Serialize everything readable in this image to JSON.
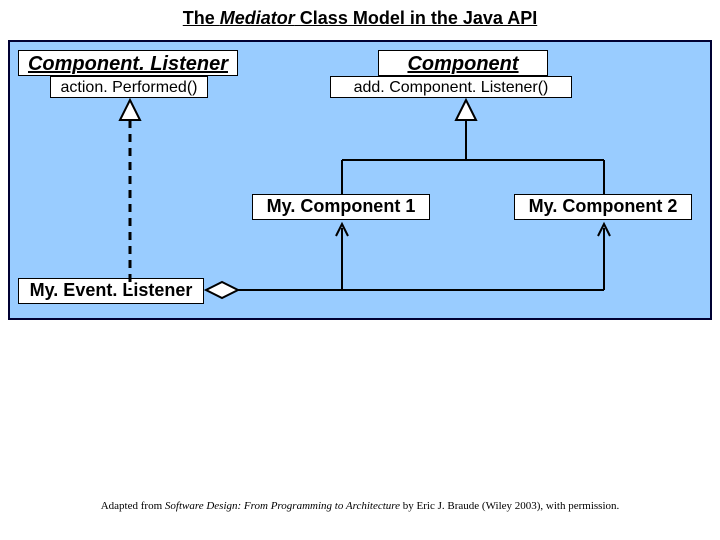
{
  "title": {
    "pre": "The ",
    "mediator": "Mediator",
    "post": " Class Model in the Java API"
  },
  "classes": {
    "componentListener": {
      "name": "Component. Listener",
      "method": "action. Performed()"
    },
    "component": {
      "name": "Component",
      "method": "add. Component. Listener()"
    },
    "myComponent1": "My. Component 1",
    "myComponent2": "My. Component 2",
    "myEventListener": "My. Event. Listener"
  },
  "footer": {
    "pre": "Adapted from ",
    "book": "Software Design: From Programming to Architecture",
    "post": " by Eric J. Braude (Wiley 2003), with permission."
  }
}
